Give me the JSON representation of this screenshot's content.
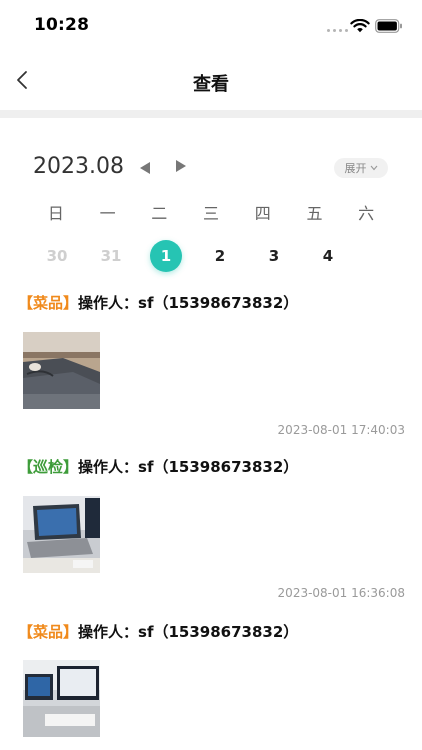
{
  "status": {
    "time": "10:28"
  },
  "nav": {
    "title": "查看"
  },
  "calendar": {
    "month": "2023.08",
    "expand_label": "展开",
    "weekdays": [
      "日",
      "一",
      "二",
      "三",
      "四",
      "五",
      "六"
    ],
    "dates": [
      "30",
      "31",
      "1",
      "2",
      "3",
      "4"
    ],
    "selected_date": "1"
  },
  "records": [
    {
      "tag": "【菜品】",
      "operator": "操作人：sf（15398673832）",
      "timestamp": "2023-08-01 17:40:03",
      "photo": "sleeve-on-desk-photo"
    },
    {
      "tag": "【巡检】",
      "operator": "操作人：sf（15398673832）",
      "timestamp": "2023-08-01 16:36:08",
      "photo": "laptop-on-desk-photo"
    },
    {
      "tag": "【菜品】",
      "operator": "操作人：sf（15398673832）",
      "timestamp": "",
      "photo": "monitor-keyboard-photo"
    }
  ],
  "colors": {
    "accent": "#26c4b3",
    "tag_orange": "#f08a1c",
    "tag_green": "#3e9c3a"
  }
}
